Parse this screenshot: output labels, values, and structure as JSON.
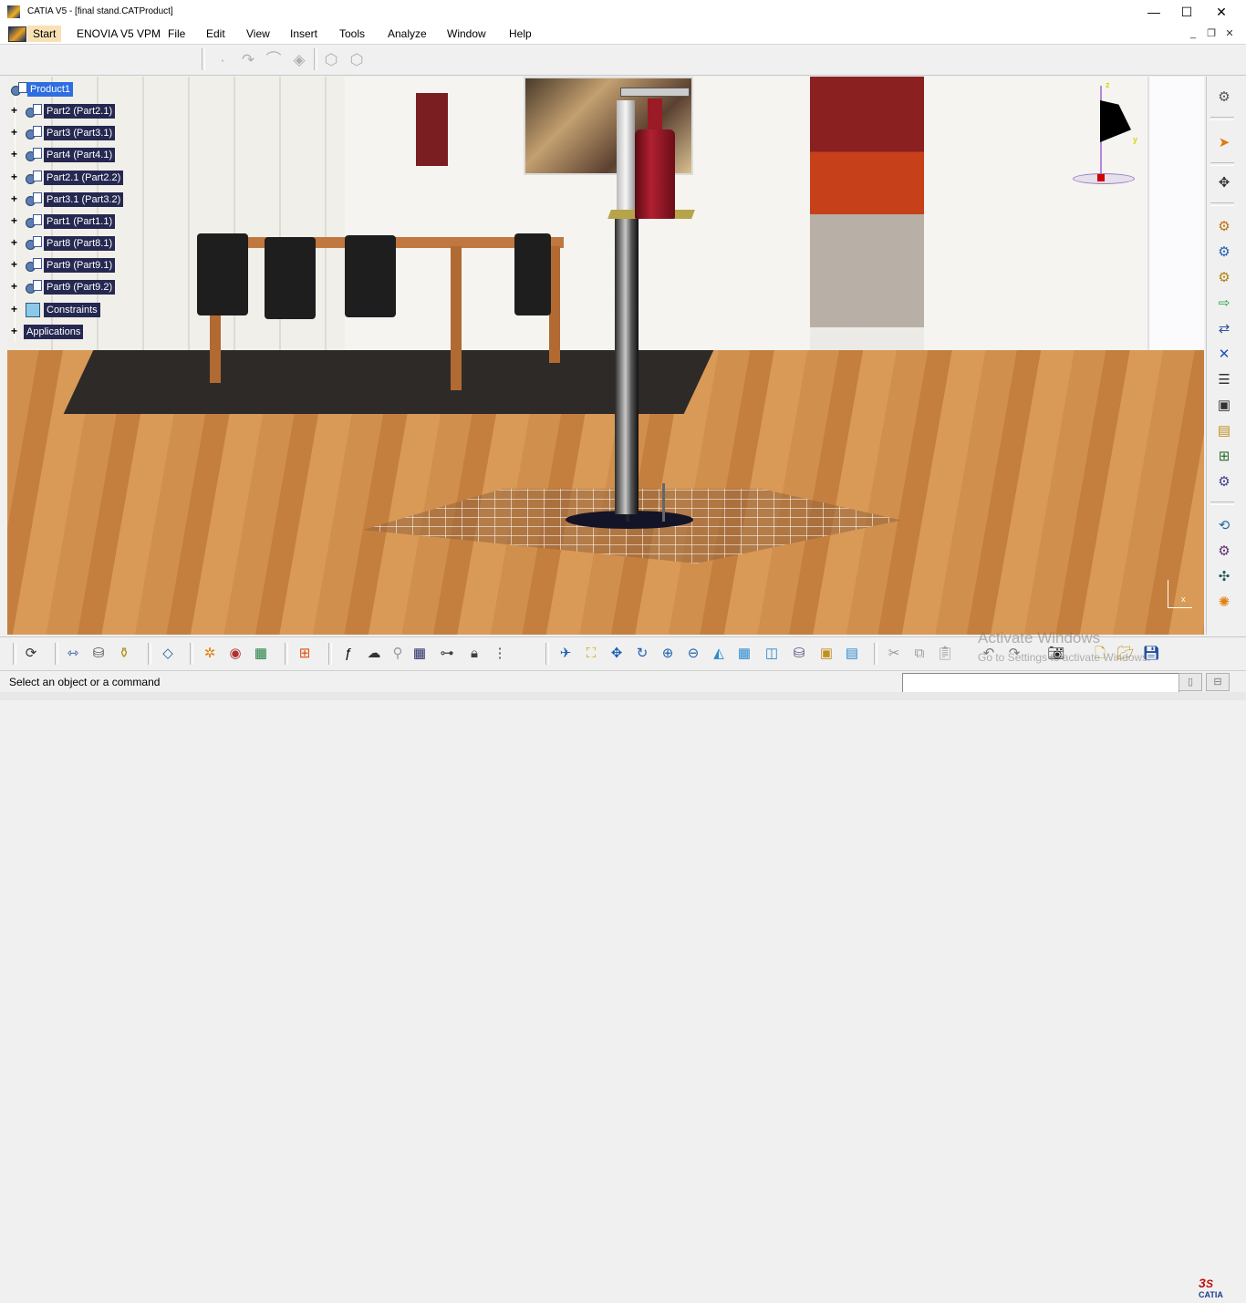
{
  "window": {
    "title": "CATIA V5 - [final stand.CATProduct]",
    "controls": {
      "minimize": "—",
      "maximize": "☐",
      "close": "✕"
    }
  },
  "menubar": {
    "items": [
      "Start",
      "ENOVIA V5 VPM",
      "File",
      "Edit",
      "View",
      "Insert",
      "Tools",
      "Analyze",
      "Window",
      "Help"
    ],
    "active": "Start",
    "mdi": {
      "minimize": "_",
      "restore": "❐",
      "close": "✕"
    }
  },
  "tree": {
    "root": "Product1",
    "children": [
      "Part2 (Part2.1)",
      "Part3 (Part3.1)",
      "Part4 (Part4.1)",
      "Part2.1 (Part2.2)",
      "Part3.1 (Part3.2)",
      "Part1 (Part1.1)",
      "Part8 (Part8.1)",
      "Part9 (Part9.1)",
      "Part9 (Part9.2)",
      "Constraints",
      "Applications"
    ]
  },
  "compass": {
    "z_label": "z",
    "y_label": "y",
    "x_label": "x"
  },
  "overlay": {
    "activate_title": "Activate Windows",
    "activate_sub": "Go to Settings to activate Windows."
  },
  "statusbar": {
    "message": "Select an object or a command",
    "command_value": ""
  },
  "icons": {
    "top": [
      "point-icon",
      "curve-icon",
      "sweep-icon",
      "eraser-icon",
      "cube-a-icon",
      "cube-b-icon"
    ],
    "right": [
      "gear-product-icon",
      "select-arrow-icon",
      "move-icon",
      "component-icon",
      "new-product-icon",
      "new-part-icon",
      "existing-component-icon",
      "replace-icon",
      "graph-tree-icon",
      "reorder-icon",
      "numbering-icon",
      "multi-instance-icon",
      "manipulate-icon",
      "snap-icon",
      "explode-icon",
      "stop-manipulate-icon",
      "smart-move-icon"
    ],
    "bottom": [
      "update-icon",
      "measure-icon",
      "inertia-icon",
      "bottle-icon",
      "sketch-icon",
      "catalog-icon",
      "material-icon",
      "apply-material-icon",
      "grid-icon",
      "formula-icon",
      "knowledge-icon",
      "design-table-icon",
      "table-icon",
      "tree-icon",
      "lock-icon",
      "rule-icon",
      "fly-icon",
      "fit-all-icon",
      "pan-icon",
      "rotate-icon",
      "zoom-in-icon",
      "zoom-out-icon",
      "normal-view-icon",
      "iso-view-icon",
      "front-view-icon",
      "shading-icon",
      "hide-show-icon",
      "swap-icon",
      "cut-icon",
      "copy-icon",
      "paste-icon",
      "undo-icon",
      "redo-icon",
      "camera-icon",
      "new-icon",
      "open-icon",
      "save-icon"
    ]
  },
  "colors": {
    "accent": "#2f6ee0",
    "tree_label_bg": "#252850",
    "menu_active": "#f7e1b5"
  }
}
